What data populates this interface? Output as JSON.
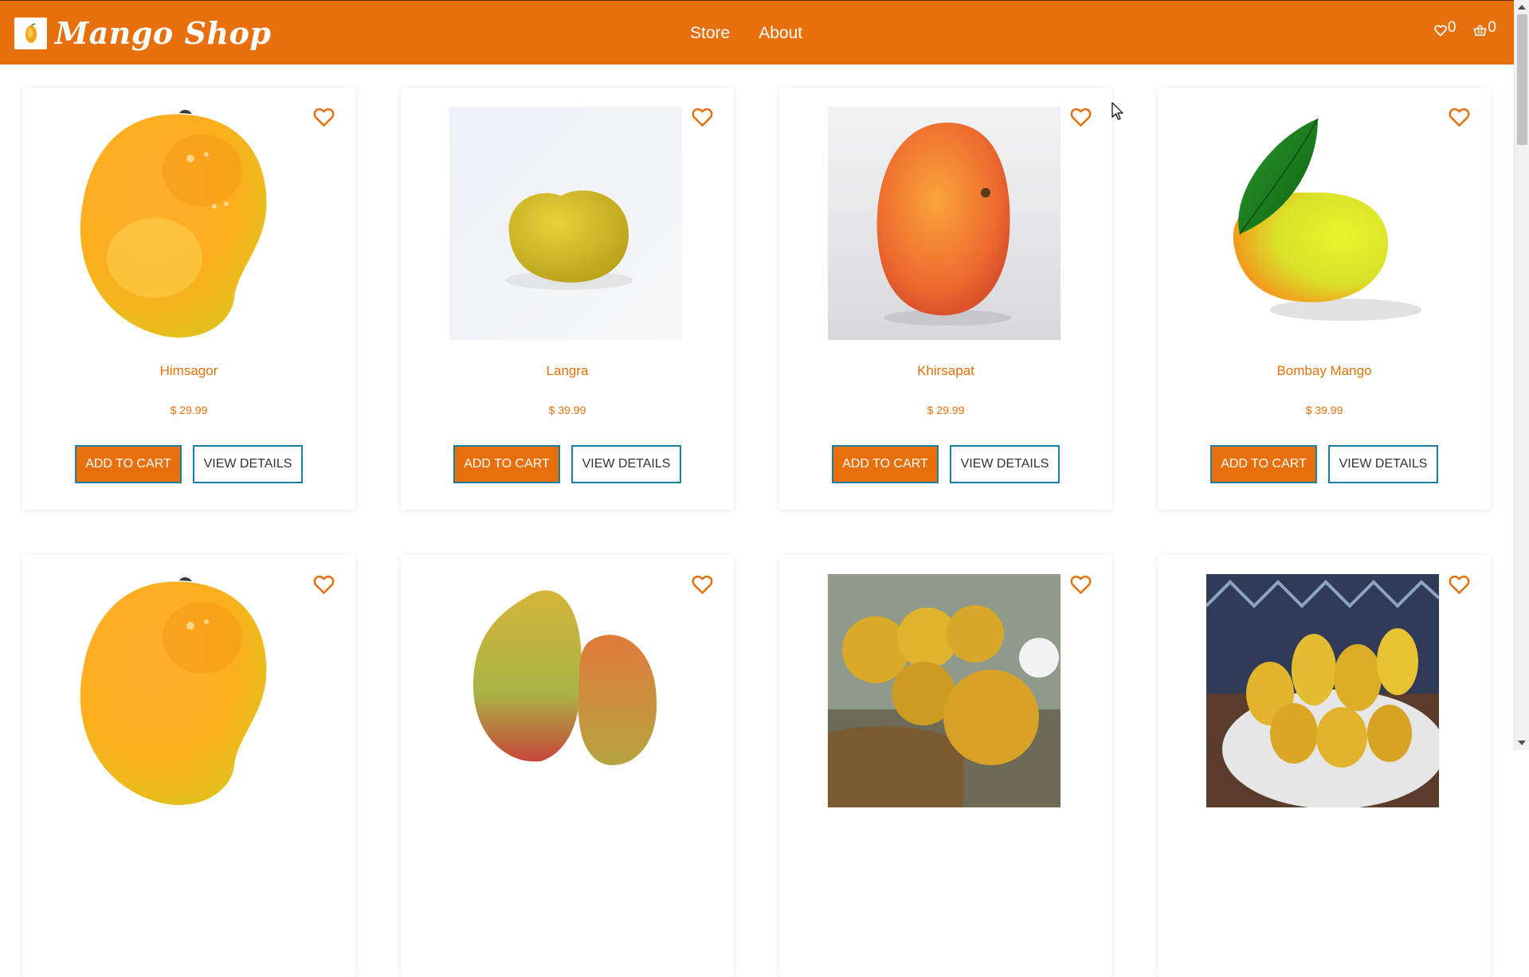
{
  "navbar": {
    "brand_name": "Mango Shop",
    "logo_icon": "mango-logo-icon",
    "links": [
      "Store",
      "About"
    ],
    "wishlist_icon": "heart-icon",
    "wishlist_count": "0",
    "cart_icon": "basket-icon",
    "cart_count": "0"
  },
  "colors": {
    "brand_orange": "#e8700c",
    "button_border": "#1b7fa3",
    "background": "#ffffff"
  },
  "products": [
    {
      "name": "Himsagor",
      "price": "$ 29.99",
      "image": "cartoon-mango-with-dew",
      "fav_icon": "heart-outline-icon"
    },
    {
      "name": "Langra",
      "price": "$ 39.99",
      "image": "yellow-mango-photo",
      "fav_icon": "heart-outline-icon"
    },
    {
      "name": "Khirsapat",
      "price": "$ 29.99",
      "image": "red-orange-mango-photo",
      "fav_icon": "heart-outline-icon"
    },
    {
      "name": "Bombay Mango",
      "price": "$ 39.99",
      "image": "cartoon-mango-with-leaf",
      "fav_icon": "heart-outline-icon"
    },
    {
      "name": "",
      "price": "",
      "image": "cartoon-mango-with-dew",
      "fav_icon": "heart-outline-icon"
    },
    {
      "name": "",
      "price": "",
      "image": "green-red-mangoes-photo",
      "fav_icon": "heart-outline-icon"
    },
    {
      "name": "",
      "price": "",
      "image": "mangoes-in-basket-photo",
      "fav_icon": "heart-outline-icon"
    },
    {
      "name": "",
      "price": "",
      "image": "bowl-of-mangoes-photo",
      "fav_icon": "heart-outline-icon"
    }
  ],
  "card_buttons": {
    "add_to_cart": "ADD TO CART",
    "view_details": "VIEW DETAILS"
  }
}
